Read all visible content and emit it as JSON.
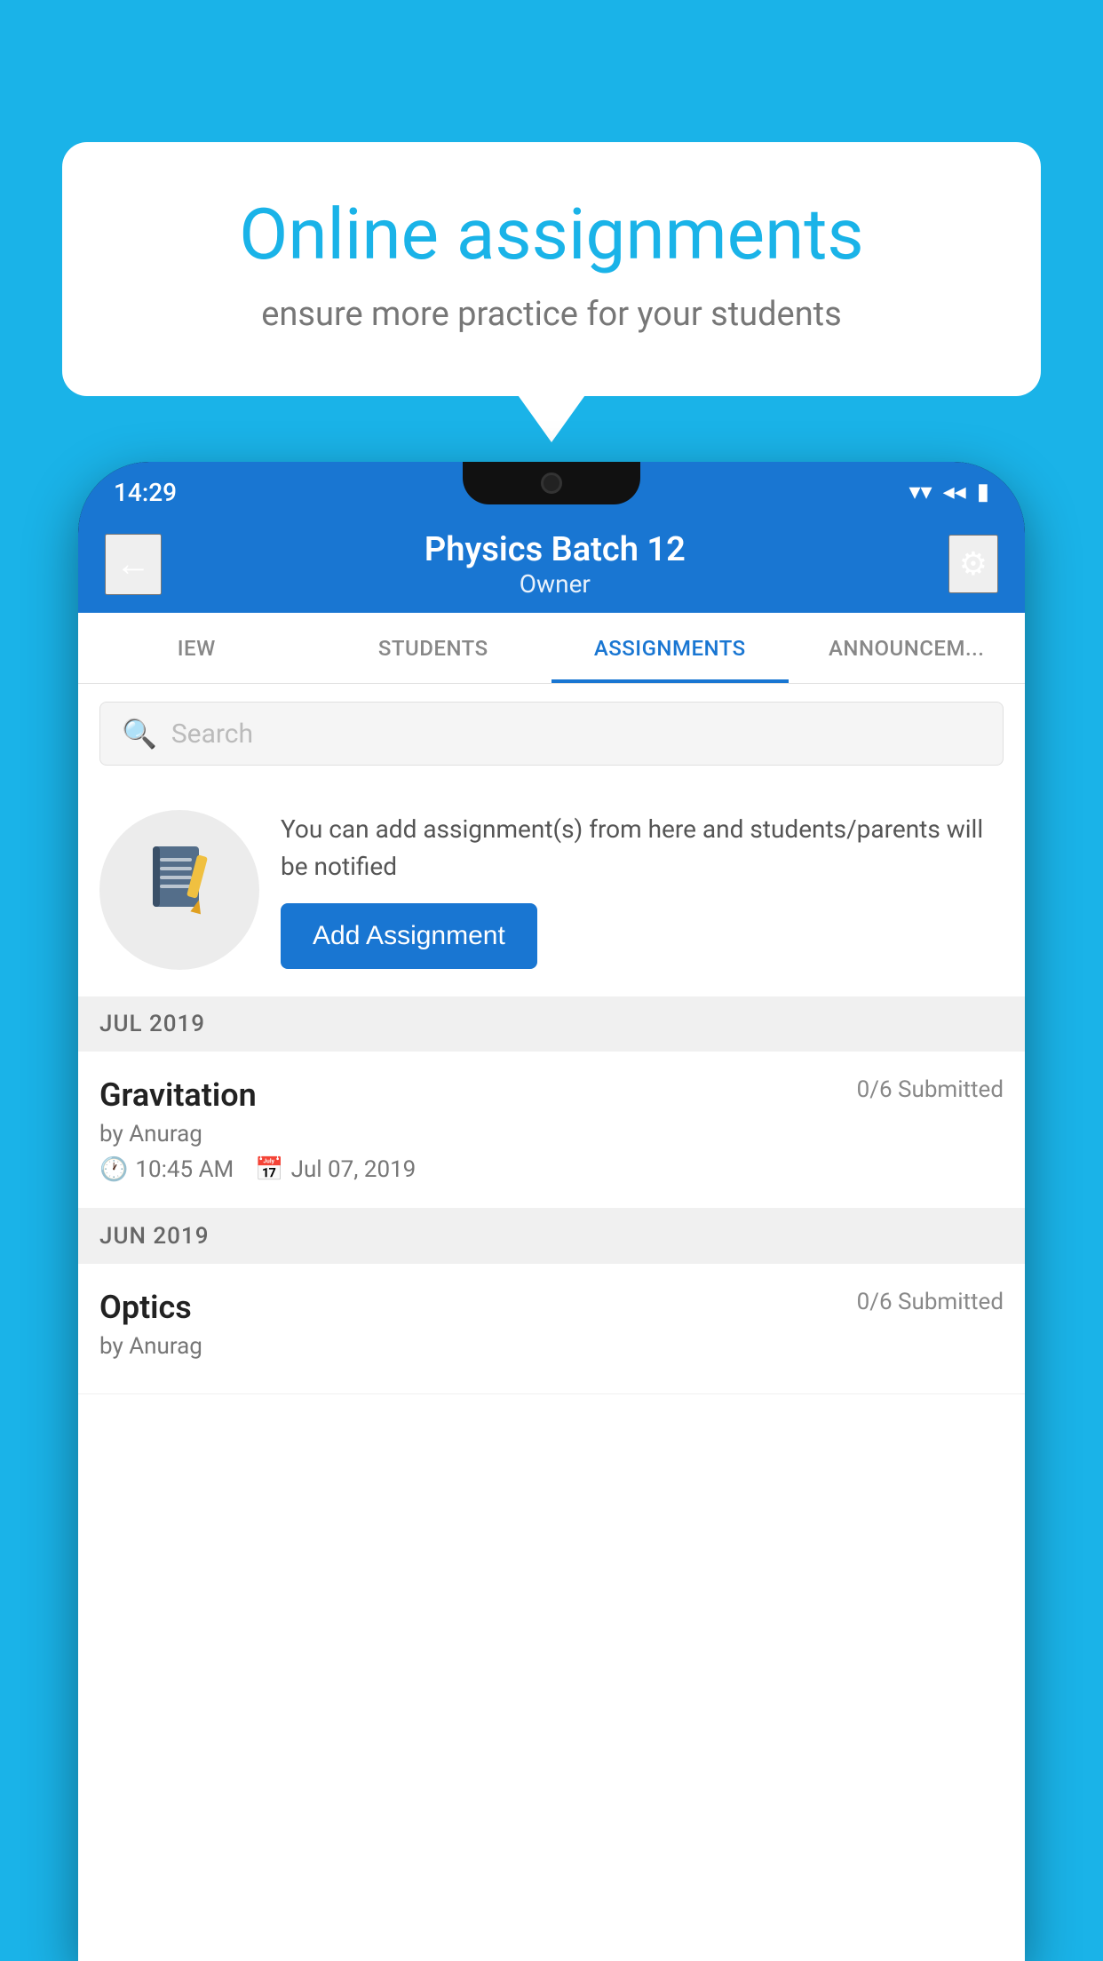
{
  "background": {
    "color": "#1ab3e8"
  },
  "speech_bubble": {
    "title": "Online assignments",
    "subtitle": "ensure more practice for your students"
  },
  "status_bar": {
    "time": "14:29",
    "wifi_icon": "▼",
    "signal_icon": "◄",
    "battery_icon": "▮"
  },
  "app_bar": {
    "back_icon": "←",
    "title": "Physics Batch 12",
    "subtitle": "Owner",
    "settings_icon": "⚙"
  },
  "tabs": [
    {
      "id": "view",
      "label": "IEW",
      "active": false
    },
    {
      "id": "students",
      "label": "STUDENTS",
      "active": false
    },
    {
      "id": "assignments",
      "label": "ASSIGNMENTS",
      "active": true
    },
    {
      "id": "announcements",
      "label": "ANNOUNCEM...",
      "active": false
    }
  ],
  "search": {
    "placeholder": "Search",
    "search_icon": "🔍"
  },
  "promo": {
    "description": "You can add assignment(s) from here and students/parents will be notified",
    "button_label": "Add Assignment"
  },
  "sections": [
    {
      "month": "JUL 2019",
      "assignments": [
        {
          "name": "Gravitation",
          "submitted": "0/6 Submitted",
          "by": "by Anurag",
          "time": "10:45 AM",
          "date": "Jul 07, 2019"
        }
      ]
    },
    {
      "month": "JUN 2019",
      "assignments": [
        {
          "name": "Optics",
          "submitted": "0/6 Submitted",
          "by": "by Anurag",
          "time": "",
          "date": ""
        }
      ]
    }
  ]
}
